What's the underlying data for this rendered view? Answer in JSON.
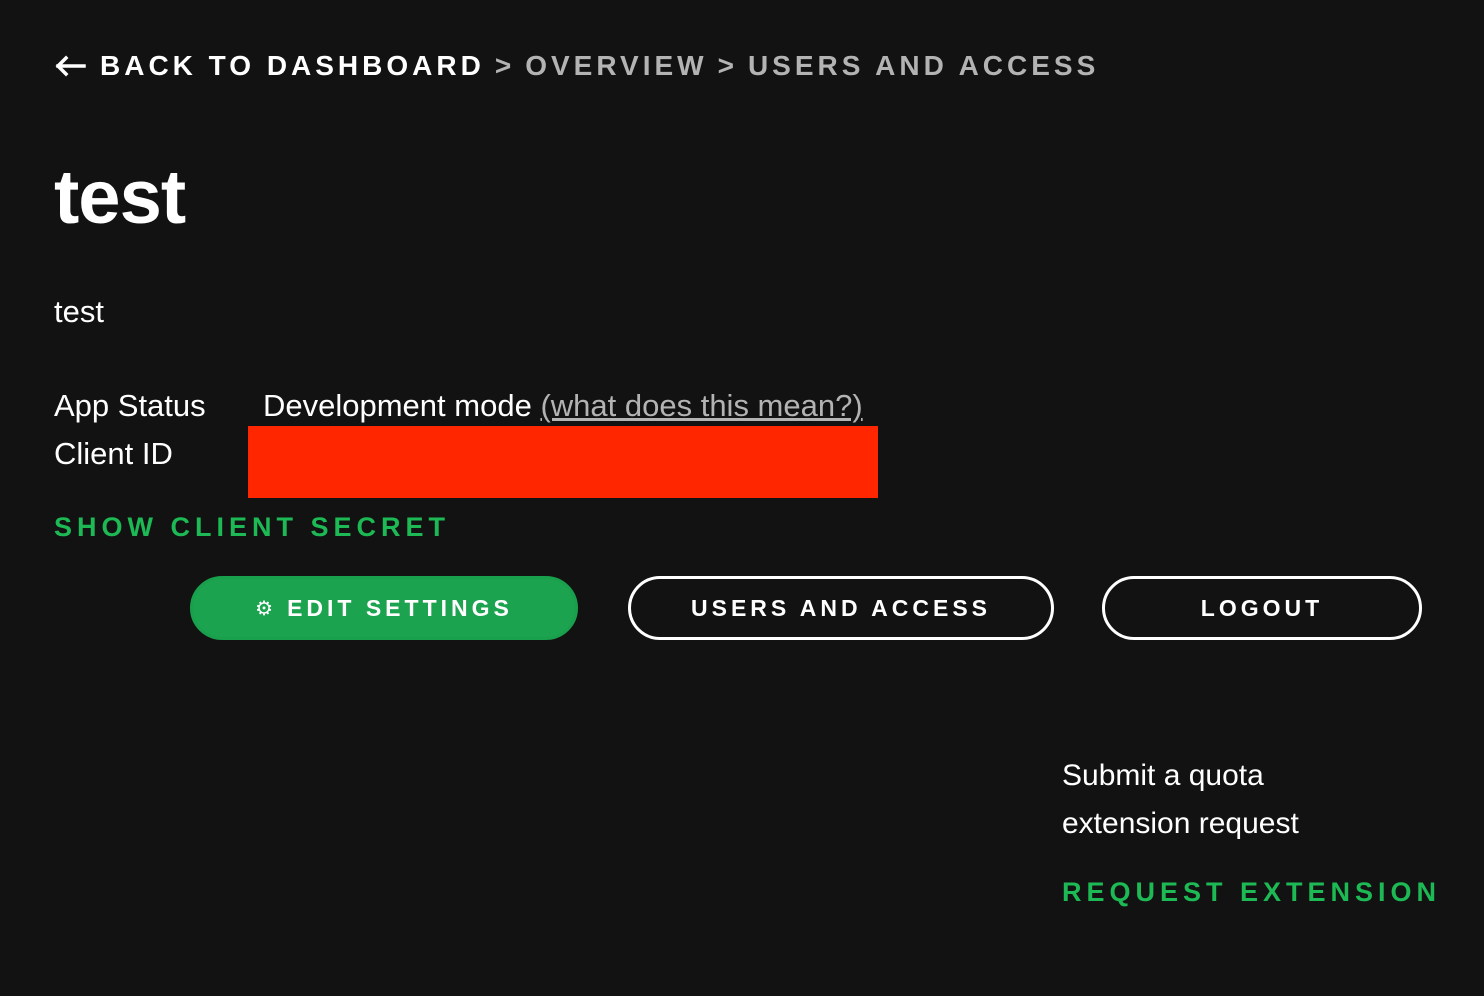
{
  "breadcrumb": {
    "back_label": "BACK TO DASHBOARD",
    "separator": ">",
    "items": [
      "OVERVIEW",
      "USERS AND ACCESS"
    ]
  },
  "app": {
    "name": "test",
    "description": "test"
  },
  "details": {
    "status_label": "App Status",
    "status_value": "Development mode",
    "status_help_link": "(what does this mean?)",
    "client_id_label": "Client ID"
  },
  "actions": {
    "show_client_secret": "SHOW CLIENT SECRET",
    "edit_settings": "EDIT SETTINGS",
    "users_and_access": "USERS AND ACCESS",
    "logout": "LOGOUT"
  },
  "quota": {
    "text": "Submit a quota extension request",
    "link": "REQUEST EXTENSION"
  },
  "colors": {
    "background": "#121212",
    "accent_green": "#1db954",
    "button_green": "#1ca350",
    "redaction_red": "#ff2600",
    "muted_text": "#b3b3b3"
  },
  "icons": [
    "back-arrow-icon",
    "gear-icon"
  ]
}
